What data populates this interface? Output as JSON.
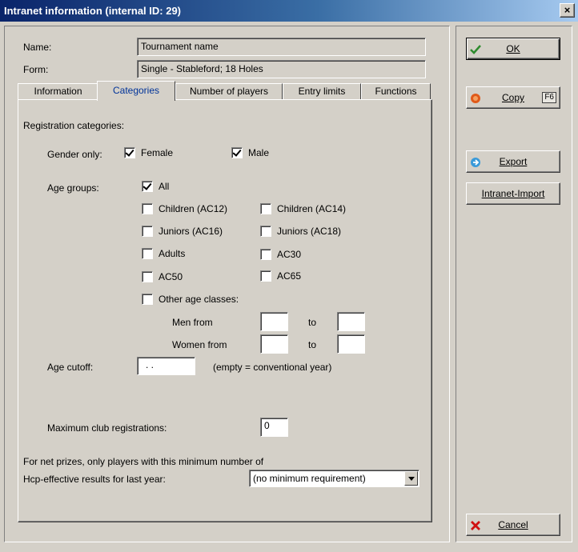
{
  "window": {
    "title": "Intranet information (internal ID: 29)",
    "close_label": "×"
  },
  "header": {
    "name_label": "Name:",
    "name_value": "Tournament name",
    "form_label": "Form:",
    "form_value": "Single - Stableford; 18 Holes"
  },
  "tabs": [
    {
      "label": "Information",
      "active": false
    },
    {
      "label": "Categories",
      "active": true
    },
    {
      "label": "Number of players",
      "active": false
    },
    {
      "label": "Entry limits",
      "active": false
    },
    {
      "label": "Functions",
      "active": false
    }
  ],
  "categories": {
    "section_title": "Registration categories:",
    "gender_label": "Gender only:",
    "gender": [
      {
        "label": "Female",
        "checked": true
      },
      {
        "label": "Male",
        "checked": true
      }
    ],
    "age_groups_label": "Age groups:",
    "age_all": {
      "label": "All",
      "checked": true
    },
    "age_options": [
      {
        "label": "Children (AC12)",
        "checked": false
      },
      {
        "label": "Children (AC14)",
        "checked": false
      },
      {
        "label": "Juniors (AC16)",
        "checked": false
      },
      {
        "label": "Juniors (AC18)",
        "checked": false
      },
      {
        "label": "Adults",
        "checked": false
      },
      {
        "label": "AC30",
        "checked": false
      },
      {
        "label": "AC50",
        "checked": false
      },
      {
        "label": "AC65",
        "checked": false
      }
    ],
    "other_age": {
      "label": "Other age classes:",
      "checked": false
    },
    "men_from_label": "Men from",
    "women_from_label": "Women from",
    "to_label": "to",
    "men_from_value": "",
    "men_to_value": "",
    "women_from_value": "",
    "women_to_value": "",
    "age_cutoff_label": "Age cutoff:",
    "age_cutoff_value": ". .",
    "age_cutoff_hint": "(empty = conventional year)",
    "max_club_label": "Maximum club registrations:",
    "max_club_value": "0",
    "net_prize_line1": "For net prizes, only players with this minimum number of",
    "net_prize_line2": "Hcp-effective results for last year:",
    "min_requirement_selected": "(no minimum requirement)"
  },
  "buttons": {
    "ok": "OK",
    "copy": "Copy",
    "copy_key": "F6",
    "export": "Export",
    "intranet_import": "Intranet-Import",
    "cancel": "Cancel"
  },
  "colors": {
    "titlebar_start": "#0a246a",
    "titlebar_end": "#a6caf0",
    "active_tab_text": "#003399",
    "ok_icon": "#2e8b2e",
    "copy_icon": "#e05a1a",
    "export_icon": "#3a9ad9",
    "cancel_icon": "#d01010"
  }
}
